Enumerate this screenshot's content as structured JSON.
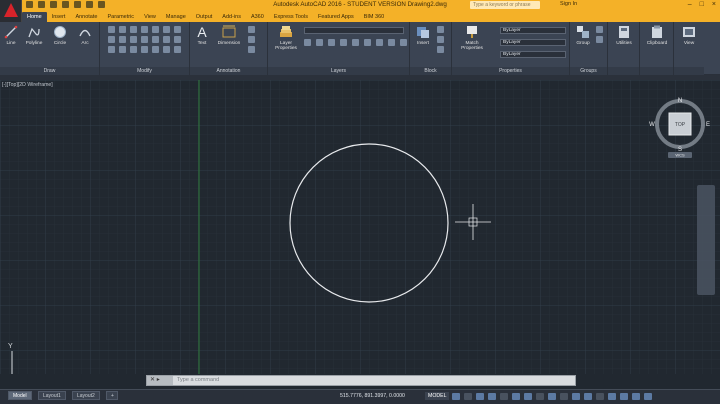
{
  "title_bar": {
    "title": "Autodesk AutoCAD 2016 - STUDENT VERSION    Drawing2.dwg",
    "search_placeholder": "Type a keyword or phrase",
    "sign_in": "Sign In"
  },
  "ribbon_tabs": [
    "Home",
    "Insert",
    "Annotate",
    "Parametric",
    "View",
    "Manage",
    "Output",
    "Add-ins",
    "A360",
    "Express Tools",
    "Featured Apps",
    "BIM 360"
  ],
  "active_tab": "Home",
  "draw_tools": [
    "Line",
    "Polyline",
    "Circle",
    "Arc"
  ],
  "annotation_tools": [
    "Text",
    "Dimension"
  ],
  "layer_tools": {
    "layer_properties": "Layer Properties"
  },
  "block_tools": {
    "insert": "Insert"
  },
  "properties_tools": {
    "match": "Match Properties",
    "color": "ByLayer",
    "linetype": "ByLayer",
    "lineweight": "ByLayer"
  },
  "group_tools": {
    "group": "Group"
  },
  "utilities": {
    "utilities": "Utilities",
    "clipboard": "Clipboard",
    "view": "View"
  },
  "panel_labels": {
    "draw": "Draw",
    "modify": "Modify",
    "annotation": "Annotation",
    "layers": "Layers",
    "block": "Block",
    "properties": "Properties",
    "groups": "Groups"
  },
  "viewport": {
    "label": "[-][Top][2D Wireframe]",
    "compass": {
      "n": "N",
      "s": "S",
      "e": "E",
      "w": "W",
      "top": "TOP",
      "wcs": "WCS"
    }
  },
  "command_line": {
    "placeholder": "Type a command"
  },
  "layout_tabs": [
    "Model",
    "Layout1",
    "Layout2"
  ],
  "active_layout": "Model",
  "status": {
    "coordinates": "515.7776, 891.3997, 0.0000",
    "mode": "MODEL"
  },
  "colors": {
    "title_bar": "#f4b128",
    "ribbon": "#3b4453",
    "canvas": "#212830",
    "grid_minor": "#2b333d",
    "grid_major": "#33404c",
    "y_axis": "#2e7a3c",
    "circle": "#e8eaed"
  }
}
